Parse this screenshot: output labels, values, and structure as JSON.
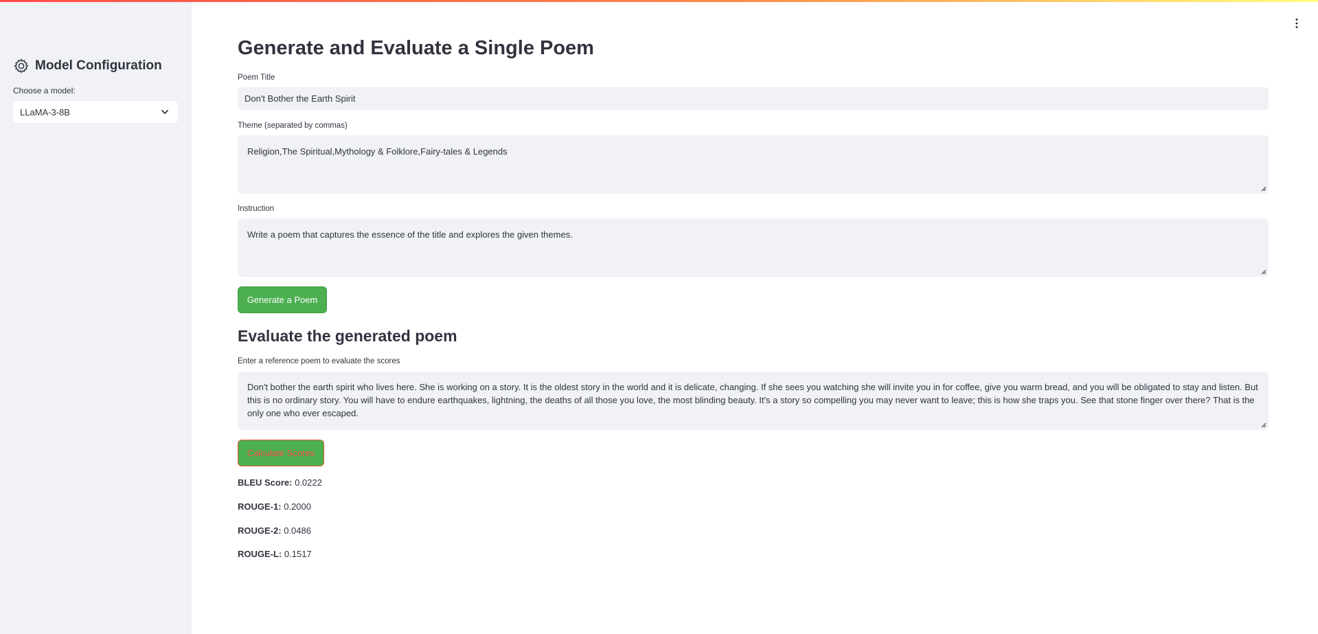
{
  "sidebar": {
    "title": "Model Configuration",
    "icon": "gear-icon",
    "select_label": "Choose a model:",
    "selected_model": "LLaMA-3-8B"
  },
  "header": {
    "menu_icon": "vertical-dots-icon"
  },
  "main": {
    "title": "Generate and Evaluate a Single Poem",
    "poem_title": {
      "label": "Poem Title",
      "value": "Don't Bother the Earth Spirit"
    },
    "theme": {
      "label": "Theme (separated by commas)",
      "value": "Religion,The Spiritual,Mythology & Folklore,Fairy-tales & Legends"
    },
    "instruction": {
      "label": "Instruction",
      "value": "Write a poem that captures the essence of the title and explores the given themes."
    },
    "generate_button": "Generate a Poem",
    "evaluate": {
      "title": "Evaluate the generated poem",
      "reference_label": "Enter a reference poem to evaluate the scores",
      "reference_value": "Don't bother the earth spirit who lives here. She is working on a story. It is the oldest story in the world and it is delicate, changing. If she sees you watching she will invite you in for coffee, give you warm bread, and you will be obligated to stay and listen. But this is no ordinary story. You will have to endure earthquakes, lightning, the deaths of all those you love, the most blinding beauty. It's a story so compelling you may never want to leave; this is how she traps you. See that stone finger over there? That is the only one who ever escaped.",
      "calculate_button": "Calculate Scores"
    },
    "scores": [
      {
        "label": "BLEU Score:",
        "value": "0.0222"
      },
      {
        "label": "ROUGE-1:",
        "value": "0.2000"
      },
      {
        "label": "ROUGE-2:",
        "value": "0.0486"
      },
      {
        "label": "ROUGE-L:",
        "value": "0.1517"
      }
    ]
  },
  "colors": {
    "primary_button": "#4CAF50",
    "sidebar_bg": "#f0f2f6",
    "text": "#31333F",
    "accent_red": "#ff4b4b"
  }
}
